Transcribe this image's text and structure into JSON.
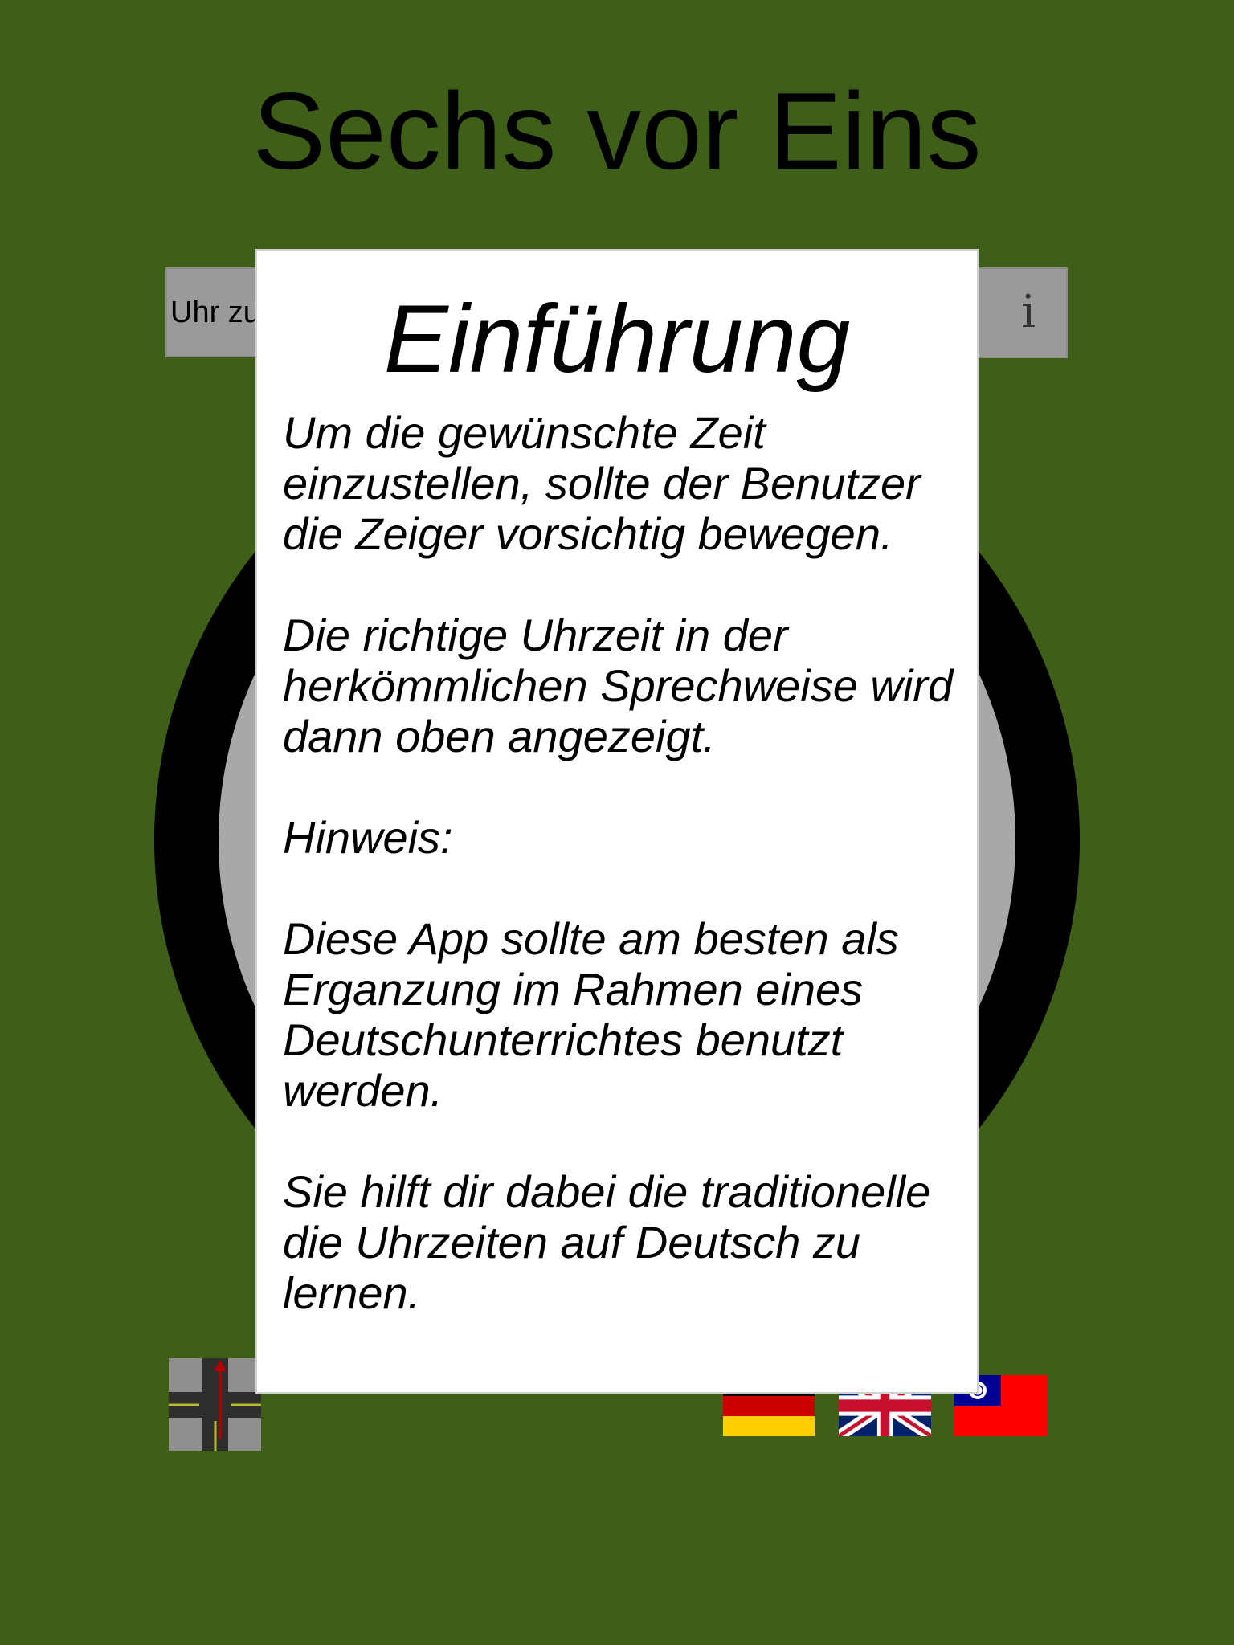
{
  "app": {
    "title": "Sechs vor Eins"
  },
  "toolbar": {
    "reset_label": "Uhr zurücksetzen",
    "info_label": "i"
  },
  "modal": {
    "title": "Einführung",
    "paragraphs": [
      "Um die gewünschte Zeit einzustellen, sollte der Benutzer die Zeiger vorsichtig bewegen.",
      "Die richtige Uhrzeit in der herkömmlichen Sprechweise wird dann oben angezeigt.",
      "Hinweis:",
      "Diese App sollte am besten als Erganzung im Rahmen eines Deutschunterrichtes benutzt werden.",
      "Sie hilft dir dabei die traditionelle die Uhrzeiten auf Deutsch zu lernen."
    ]
  },
  "footer": {
    "mode_icon": "road-junction-icon",
    "languages": [
      {
        "code": "de",
        "icon": "germany-flag-icon"
      },
      {
        "code": "en",
        "icon": "uk-flag-icon"
      },
      {
        "code": "zh-tw",
        "icon": "taiwan-flag-icon"
      }
    ]
  },
  "colors": {
    "background": "#3f5e17",
    "button": "#9a9a9a",
    "clock_ring": "#000000",
    "clock_face": "#a8a8a8",
    "modal": "#ffffff"
  }
}
